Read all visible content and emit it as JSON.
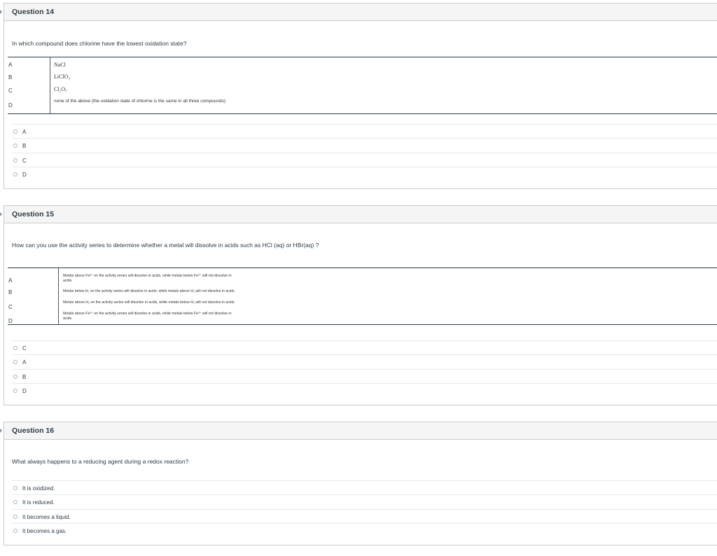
{
  "questions": [
    {
      "title": "Question 14",
      "text": "In which compound does chlorine have the lowest oxidation state?",
      "options": [
        {
          "letter": "A",
          "text": "NaCl"
        },
        {
          "letter": "B",
          "text": "LiClO₃"
        },
        {
          "letter": "C",
          "text": "Cl₂O₇"
        },
        {
          "letter": "D",
          "text": "none of the above (the oxidation state of chlorine is the same in all three compounds)"
        }
      ],
      "answers": [
        "A",
        "B",
        "C",
        "D"
      ]
    },
    {
      "title": "Question 15",
      "text": "How can you use the activity series to determine whether a metal will dissolve in acids such as HCl (aq)  or HBr(aq) ?",
      "options": [
        {
          "letter": "A",
          "line1": "Metals above Fe²⁺ on the activity series will dissolve in acids, while metals below Fe²⁺ will not dissolve in",
          "line2": "acids."
        },
        {
          "letter": "B",
          "line1": "Metals below H₂ on the activity series will dissolve in acids, while metals above H₂ will not dissolve in acids.",
          "line2": ""
        },
        {
          "letter": "C",
          "line1": "Metals above H₂ on the activity series will dissolve in acids, while metals below H₂ will not dissolve in acids.",
          "line2": ""
        },
        {
          "letter": "D",
          "line1": "Metals above Fe³⁺ on the activity series will dissolve in acids, while metals below Fe³⁺ will not dissolve in",
          "line2": "acids."
        }
      ],
      "answers": [
        "C",
        "A",
        "B",
        "D"
      ]
    },
    {
      "title": "Question 16",
      "text": "What always happens to a reducing agent during a redox reaction?",
      "answers": [
        "It is oxidized.",
        "It is reduced.",
        "It becomes a liquid.",
        "It becomes a gas."
      ]
    }
  ]
}
